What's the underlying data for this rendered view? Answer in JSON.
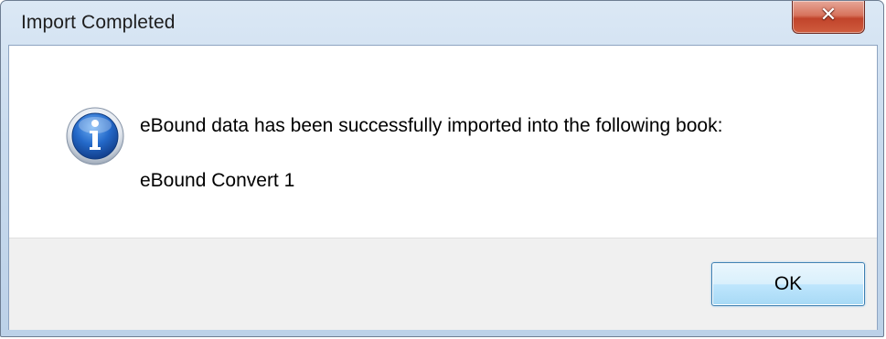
{
  "window": {
    "title": "Import Completed",
    "close_icon": "close-icon"
  },
  "dialog": {
    "icon": "info-icon",
    "message": "eBound data has been successfully imported into the following book:",
    "book_name": "eBound Convert 1"
  },
  "buttons": {
    "ok_label": "OK"
  },
  "colors": {
    "close_button": "#c1442b",
    "ok_button_border": "#3c7fb1",
    "info_icon_blue": "#1f64c4"
  }
}
